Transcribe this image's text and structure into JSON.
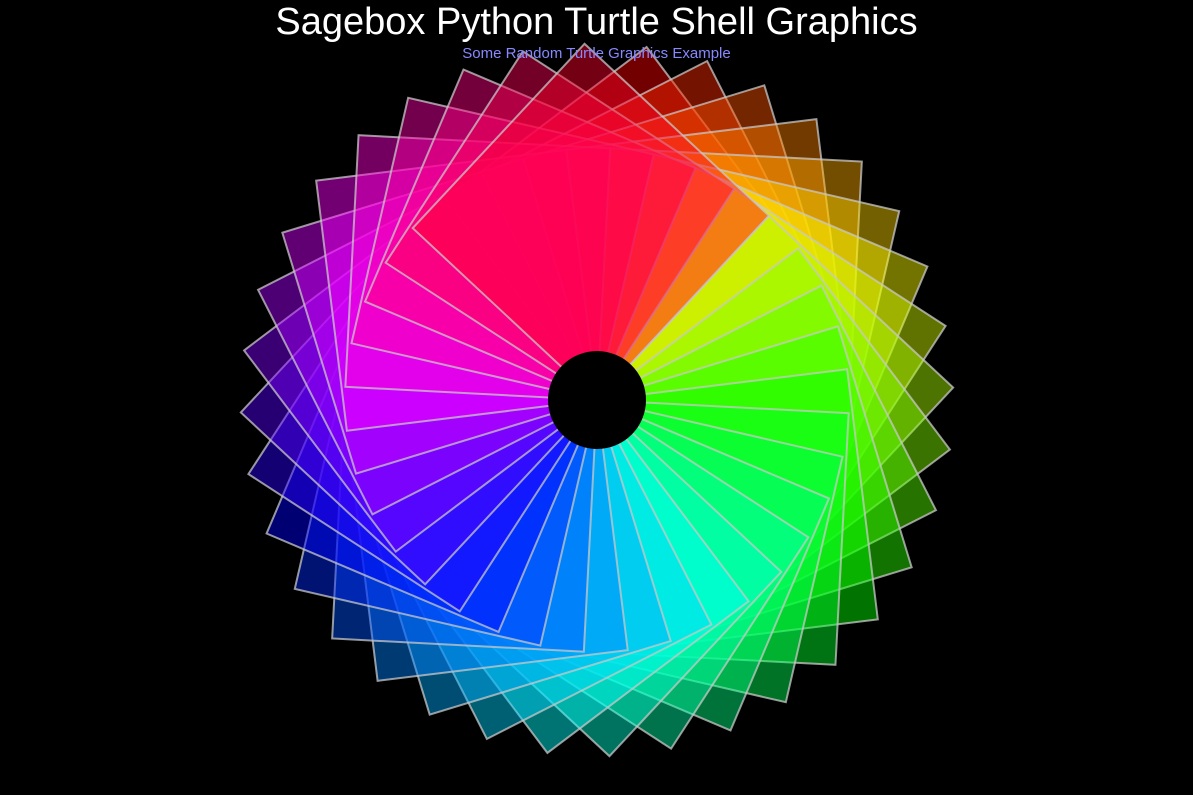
{
  "window": {
    "title": "Sagebox Python Turtle Shell Graphics",
    "subtitle": "Some Random Turtle Graphics Example",
    "background_color": "#000000",
    "title_color": "#ffffff",
    "subtitle_color": "#8888ff"
  },
  "graphic": {
    "shape": "rotated-square-rosette",
    "square_count": 36,
    "outline_color": "#c8c8c8",
    "fill_opacity": 0.45,
    "center_color": "#000000",
    "hue_sequence": "rainbow"
  }
}
